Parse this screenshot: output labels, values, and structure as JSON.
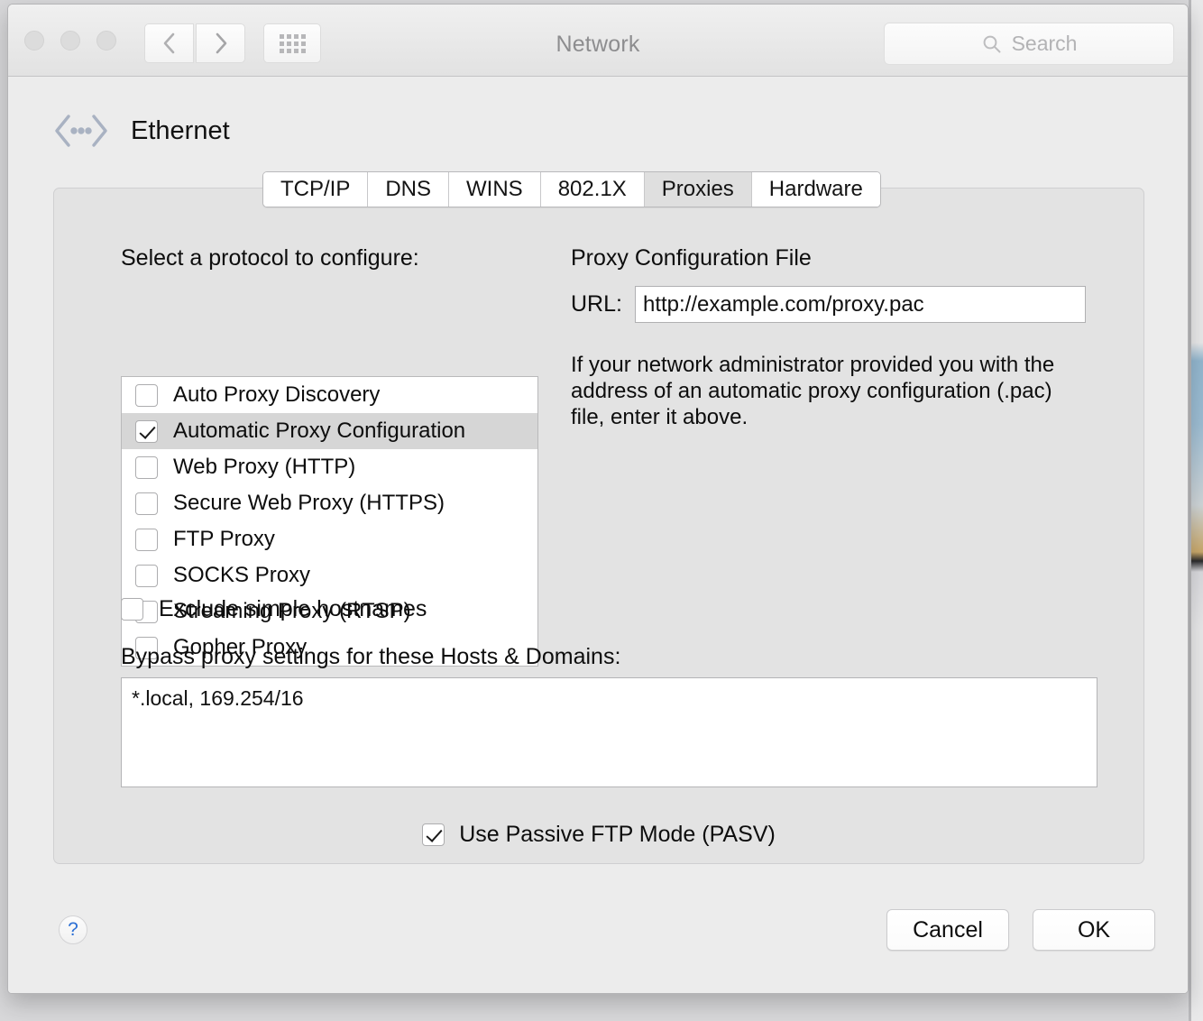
{
  "window": {
    "title": "Network",
    "traffic_lights": [
      "close",
      "minimize",
      "zoom"
    ],
    "nav_back_icon": "chevron-left-icon",
    "nav_forward_icon": "chevron-right-icon",
    "grid_icon": "show-all-grid-icon",
    "search": {
      "placeholder": "Search",
      "icon": "search-icon",
      "value": ""
    }
  },
  "service": {
    "name": "Ethernet",
    "icon": "ethernet-chevrons-icon"
  },
  "tabs": [
    {
      "label": "TCP/IP",
      "selected": false
    },
    {
      "label": "DNS",
      "selected": false
    },
    {
      "label": "WINS",
      "selected": false
    },
    {
      "label": "802.1X",
      "selected": false
    },
    {
      "label": "Proxies",
      "selected": true
    },
    {
      "label": "Hardware",
      "selected": false
    }
  ],
  "proxies": {
    "protocol_label": "Select a protocol to configure:",
    "protocols": [
      {
        "label": "Auto Proxy Discovery",
        "checked": false,
        "selected": false
      },
      {
        "label": "Automatic Proxy Configuration",
        "checked": true,
        "selected": true
      },
      {
        "label": "Web Proxy (HTTP)",
        "checked": false,
        "selected": false
      },
      {
        "label": "Secure Web Proxy (HTTPS)",
        "checked": false,
        "selected": false
      },
      {
        "label": "FTP Proxy",
        "checked": false,
        "selected": false
      },
      {
        "label": "SOCKS Proxy",
        "checked": false,
        "selected": false
      },
      {
        "label": "Streaming Proxy (RTSP)",
        "checked": false,
        "selected": false
      },
      {
        "label": "Gopher Proxy",
        "checked": false,
        "selected": false
      }
    ],
    "exclude_simple_hostnames": {
      "label": "Exclude simple hostnames",
      "checked": false
    },
    "bypass_label": "Bypass proxy settings for these Hosts & Domains:",
    "bypass_value": "*.local, 169.254/16",
    "passive_ftp": {
      "label": "Use Passive FTP Mode (PASV)",
      "checked": true
    }
  },
  "pac": {
    "title": "Proxy Configuration File",
    "url_label": "URL:",
    "url_value": "http://example.com/proxy.pac",
    "help_text": "If your network administrator provided you with the address of an automatic proxy configuration (.pac) file, enter it above."
  },
  "footer": {
    "help_glyph": "?",
    "cancel_label": "Cancel",
    "ok_label": "OK"
  },
  "colors": {
    "window_bg": "#ececec",
    "panel_bg": "#e3e3e3",
    "selected_row": "#d6d6d6",
    "selected_tab": "#dfdfdf",
    "accent": "#2b6fd4",
    "text": "#0d0d0d"
  }
}
